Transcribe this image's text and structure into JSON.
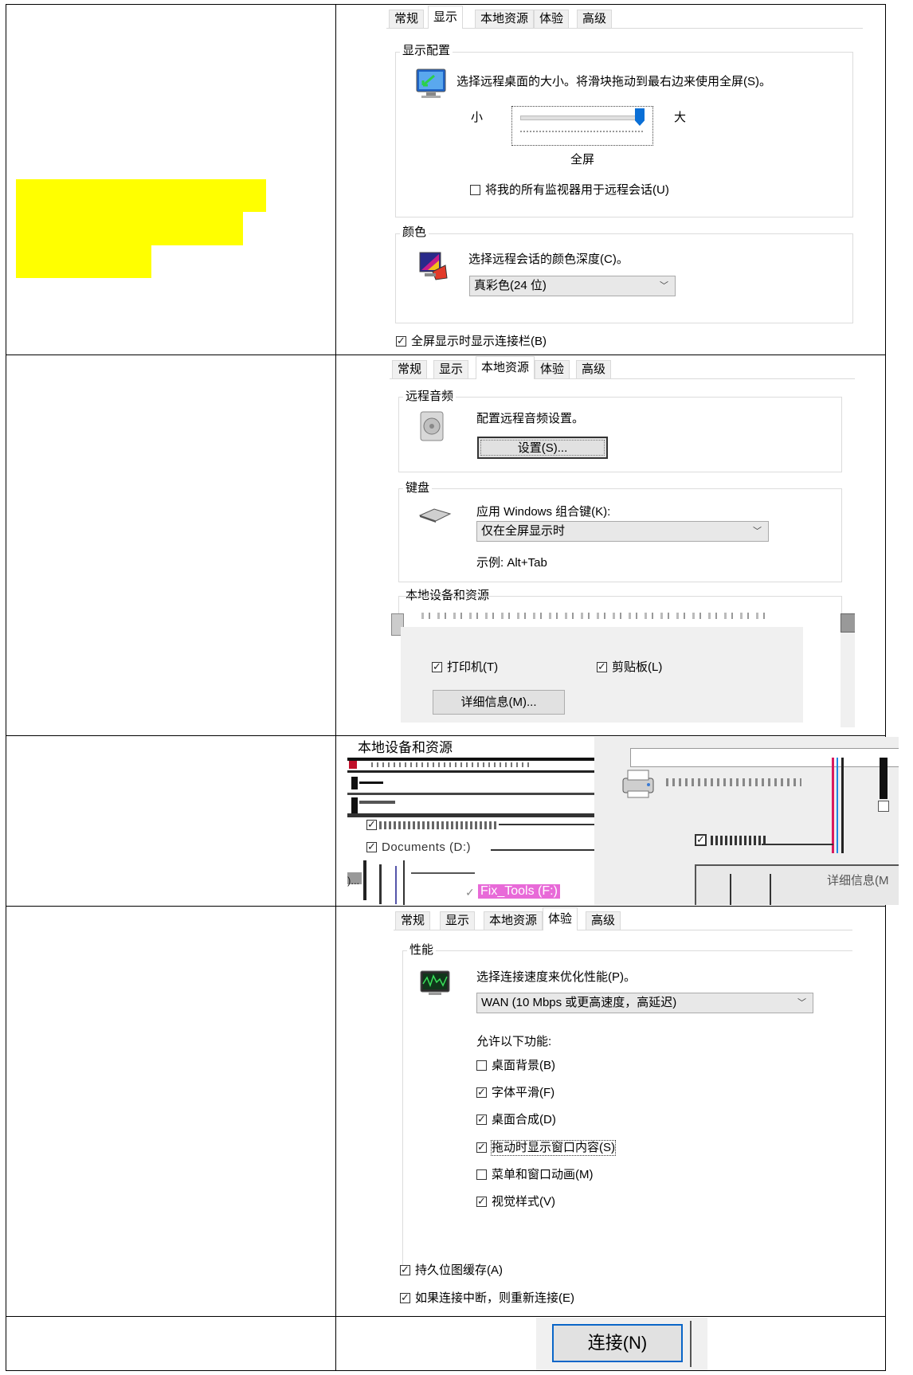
{
  "display_tab": {
    "tabs": [
      "常规",
      "显示",
      "本地资源",
      "体验",
      "高级"
    ],
    "display_config_title": "显示配置",
    "display_config_desc": "选择远程桌面的大小。将滑块拖动到最右边来使用全屏(S)。",
    "slider_small": "小",
    "slider_large": "大",
    "slider_value_label": "全屏",
    "all_monitors_label": "将我的所有监视器用于远程会话(U)",
    "color_title": "颜色",
    "color_desc": "选择远程会话的颜色深度(C)。",
    "color_depth_value": "真彩色(24 位)",
    "show_bar_label": "全屏显示时显示连接栏(B)"
  },
  "local_tab": {
    "tabs": [
      "常规",
      "显示",
      "本地资源",
      "体验",
      "高级"
    ],
    "audio_title": "远程音频",
    "audio_desc": "配置远程音频设置。",
    "audio_settings_button": "设置(S)...",
    "keyboard_title": "键盘",
    "keyboard_desc": "应用 Windows 组合键(K):",
    "keyboard_value": "仅在全屏显示时",
    "keyboard_example": "示例: Alt+Tab",
    "devices_title": "本地设备和资源",
    "printer_label": "打印机(T)",
    "clipboard_label": "剪贴板(L)",
    "details_button": "详细信息(M)..."
  },
  "devices_glitch": {
    "title": "本地设备和资源",
    "item_documents": "Documents (D:)",
    "item_fix_tools": "Fix_Tools (F:)",
    "details_fragment": "详细信息(M"
  },
  "experience_tab": {
    "tabs": [
      "常规",
      "显示",
      "本地资源",
      "体验",
      "高级"
    ],
    "performance_title": "性能",
    "speed_desc": "选择连接速度来优化性能(P)。",
    "speed_value": "WAN (10 Mbps 或更高速度，高延迟)",
    "allow_label": "允许以下功能:",
    "options": [
      {
        "label": "桌面背景(B)",
        "checked": false
      },
      {
        "label": "字体平滑(F)",
        "checked": true
      },
      {
        "label": "桌面合成(D)",
        "checked": true
      },
      {
        "label": "拖动时显示窗口内容(S)",
        "checked": true
      },
      {
        "label": "菜单和窗口动画(M)",
        "checked": false
      },
      {
        "label": "视觉样式(V)",
        "checked": true
      }
    ],
    "persistent_cache_label": "持久位图缓存(A)",
    "reconnect_label": "如果连接中断，则重新连接(E)"
  },
  "connect_button": "连接(N)"
}
